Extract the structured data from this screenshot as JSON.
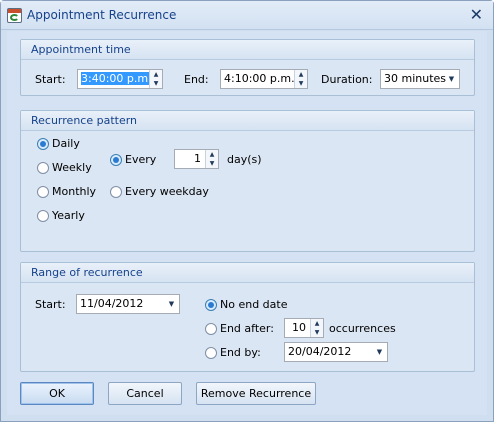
{
  "window": {
    "title": "Appointment Recurrence",
    "close_icon": "close-x-icon"
  },
  "appointment_time": {
    "header": "Appointment time",
    "start_label": "Start:",
    "start_value": "3:40:00 p.m.",
    "end_label": "End:",
    "end_value": "4:10:00 p.m.",
    "duration_label": "Duration:",
    "duration_value": "30 minutes"
  },
  "recurrence_pattern": {
    "header": "Recurrence pattern",
    "options": [
      "Daily",
      "Weekly",
      "Monthly",
      "Yearly"
    ],
    "selected": "Daily",
    "every_label": "Every",
    "every_value": "1",
    "every_unit": "day(s)",
    "every_weekday_label": "Every weekday"
  },
  "range_of_recurrence": {
    "header": "Range of recurrence",
    "start_label": "Start:",
    "start_value": "11/04/2012",
    "no_end_date_label": "No end date",
    "end_after_label": "End after:",
    "end_after_value": "10",
    "occurrences_label": "occurrences",
    "end_by_label": "End by:",
    "end_by_value": "20/04/2012"
  },
  "buttons": {
    "ok": "OK",
    "cancel": "Cancel",
    "remove": "Remove Recurrence"
  }
}
